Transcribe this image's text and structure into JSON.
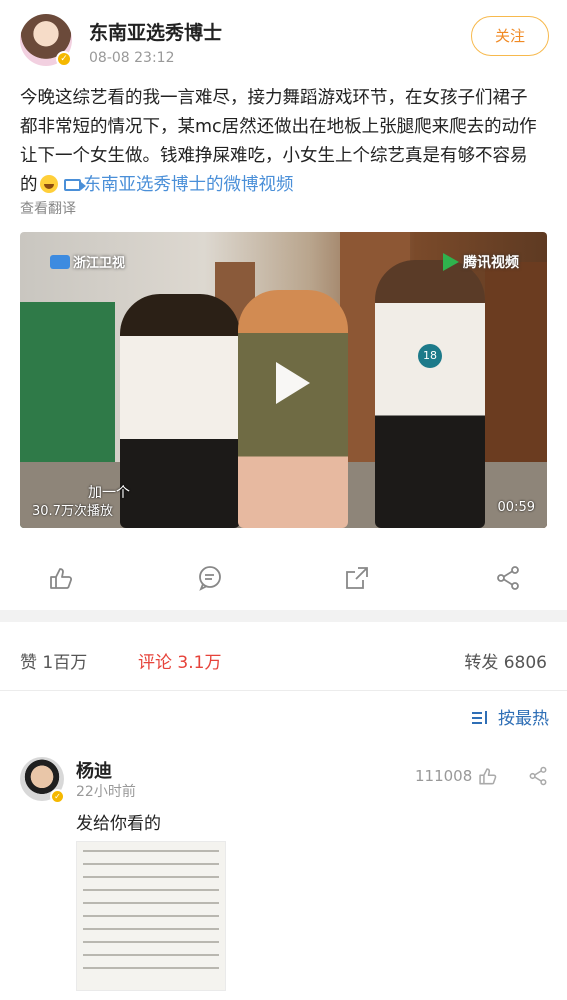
{
  "post": {
    "author": "东南亚选秀博士",
    "time": "08-08 23:12",
    "follow_label": "关注",
    "text_line1": "今晚这综艺看的我一言难尽，接力舞蹈游戏环节，在女孩子们裙子",
    "text_line2": "都非常短的情况下，某mc居然还做出在地板上张腿爬来爬去的动作",
    "text_line3": "让下一个女生做。钱难挣屎难吃，小女生上个综艺真是有够不容易",
    "text_line4_prefix": "的",
    "video_link": "东南亚选秀博士的微博视频",
    "translate_label": "查看翻译"
  },
  "video": {
    "channel_logo": "浙江卫视",
    "platform_logo": "腾讯视频",
    "caption": "加一个",
    "play_count": "30.7万次播放",
    "duration": "00:59",
    "contestant_number": "18"
  },
  "actions": {
    "icons": [
      "like-icon",
      "comment-icon",
      "share-icon",
      "forward-icon"
    ]
  },
  "stats": {
    "likes": "赞  1百万",
    "comments": "评论  3.1万",
    "reposts": "转发  6806"
  },
  "sort": {
    "label": "按最热"
  },
  "comment": {
    "author": "杨迪",
    "time": "22小时前",
    "likes": "111008",
    "text": "发给你看的"
  },
  "colors": {
    "accent_orange": "#f08a24",
    "link_blue": "#4a8fd8",
    "comment_red": "#e6433a",
    "sort_blue": "#2f6fb6"
  }
}
